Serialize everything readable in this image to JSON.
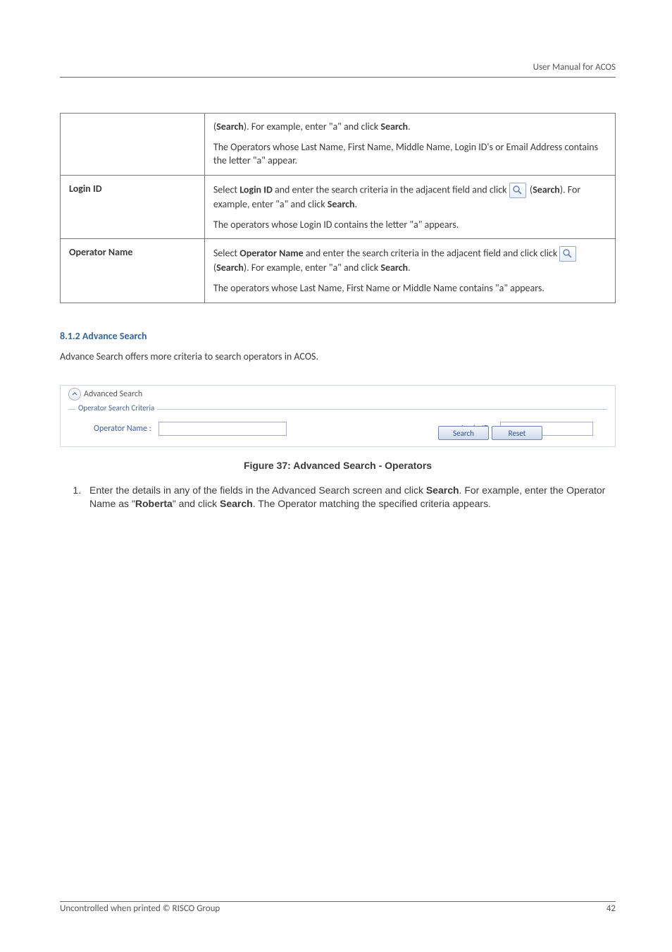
{
  "header": {
    "title": "User Manual for ACOS"
  },
  "table": {
    "row0": {
      "label": "",
      "p1": {
        "pre": "(",
        "b1": "Search",
        "mid": "). For example, enter \"a\" and click ",
        "b2": "Search",
        "post": "."
      },
      "p2": "The Operators whose Last Name, First Name, Middle Name, Login ID's or Email Address contains the letter \"a\" appear."
    },
    "row1": {
      "label": "Login ID",
      "p1": {
        "pre": "Select ",
        "b1": "Login ID",
        "post": " and enter the search criteria in the adjacent field and click "
      },
      "p1b": {
        "pre": " (",
        "b1": "Search",
        "mid": "). For example, enter \"a\" and click ",
        "b2": "Search",
        "post": "."
      },
      "p2": "The operators whose Login ID contains the letter \"a\" appears."
    },
    "row2": {
      "label": "Operator Name",
      "p1": {
        "pre": "Select ",
        "b1": "Operator Name",
        "post": " and enter the search criteria in the adjacent field and click "
      },
      "p1b": {
        "pre": " (",
        "b1": "Search",
        "mid": "). For example, enter \"a\" and click ",
        "b2": "Search",
        "post": "."
      },
      "p2": "The operators whose Last Name, First Name or Middle Name contains \"a\" appears."
    }
  },
  "section": {
    "heading": "8.1.2  Advance Search",
    "intro": "Advance Search offers more criteria to search operators in ACOS."
  },
  "adv": {
    "title": "Advanced Search",
    "subtitle": "Operator Search Criteria",
    "operator_label": "Operator Name :",
    "login_label": "Login ID :",
    "search_btn": "Search",
    "reset_btn": "Reset"
  },
  "figure": {
    "caption": "Figure 37: Advanced Search - Operators"
  },
  "step": {
    "pre": "Enter the details in any of the fields in the Advanced Search screen and click ",
    "b1": "Search",
    "mid1": ". For example, enter the Operator Name as \"",
    "b2": "Roberta",
    "mid2": "\" and click ",
    "b3": "Search",
    "post": ". The Operator matching the specified criteria appears."
  },
  "footer": {
    "left": "Uncontrolled when printed © RISCO Group",
    "page": "42"
  }
}
